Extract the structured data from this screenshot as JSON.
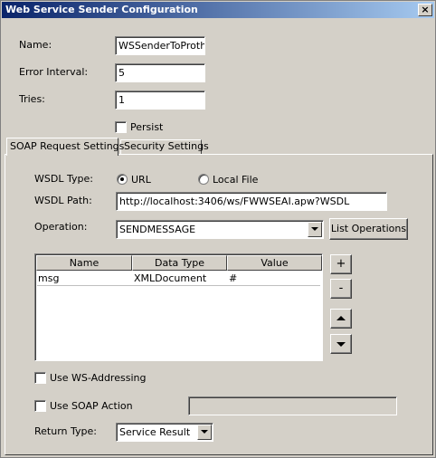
{
  "window": {
    "title": "Web Service Sender Configuration",
    "close_glyph": "×"
  },
  "form": {
    "name_label": "Name:",
    "name_value": "WSSenderToProthe",
    "error_interval_label": "Error Interval:",
    "error_interval_value": "5",
    "tries_label": "Tries:",
    "tries_value": "1",
    "persist_label": "Persist"
  },
  "tabs": [
    {
      "label": "SOAP Request Settings",
      "active": true
    },
    {
      "label": "Security Settings",
      "active": false
    }
  ],
  "soap": {
    "wsdl_type_label": "WSDL Type:",
    "wsdl_type_options": [
      "URL",
      "Local File"
    ],
    "wsdl_type_selected": "URL",
    "wsdl_path_label": "WSDL Path:",
    "wsdl_path_value": "http://localhost:3406/ws/FWWSEAI.apw?WSDL",
    "operation_label": "Operation:",
    "operation_value": "SENDMESSAGE",
    "list_operations_button": "List Operations",
    "table": {
      "columns": [
        "Name",
        "Data Type",
        "Value"
      ],
      "rows": [
        {
          "name": "msg",
          "data_type": "XMLDocument",
          "value": "#"
        }
      ]
    },
    "add_button": "+",
    "remove_button": "-",
    "use_ws_addressing_label": "Use WS-Addressing",
    "use_soap_action_label": "Use SOAP Action",
    "soap_action_value": "",
    "return_type_label": "Return Type:",
    "return_type_value": "Service Result"
  }
}
